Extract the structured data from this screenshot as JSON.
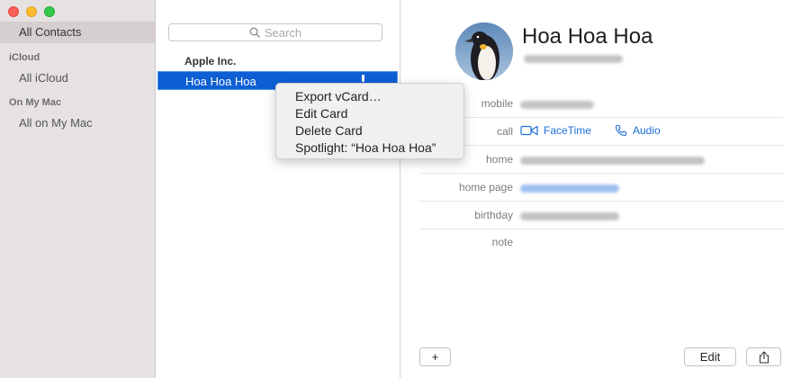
{
  "sidebar": {
    "selected_label": "All Contacts",
    "groups": [
      {
        "title": "iCloud",
        "items": [
          "All iCloud"
        ]
      },
      {
        "title": "On My Mac",
        "items": [
          "All on My Mac"
        ]
      }
    ]
  },
  "list": {
    "search_placeholder": "Search",
    "contacts": [
      "Apple Inc.",
      "Hoa Hoa Hoa"
    ],
    "selected_contact": "Hoa Hoa Hoa"
  },
  "context_menu": {
    "items": [
      "Export vCard…",
      "Edit Card",
      "Delete Card",
      "Spotlight: “Hoa Hoa Hoa”"
    ]
  },
  "detail": {
    "name": "Hoa Hoa Hoa",
    "labels": {
      "mobile": "mobile",
      "call": "call",
      "home": "home",
      "home_page": "home page",
      "birthday": "birthday",
      "note": "note"
    },
    "call_actions": {
      "facetime": "FaceTime",
      "audio": "Audio"
    },
    "buttons": {
      "add": "+",
      "edit": "Edit"
    }
  },
  "colors": {
    "selection": "#0d5fd3",
    "link": "#1b6fd6",
    "sidebar_bg": "#e6e2e2"
  }
}
